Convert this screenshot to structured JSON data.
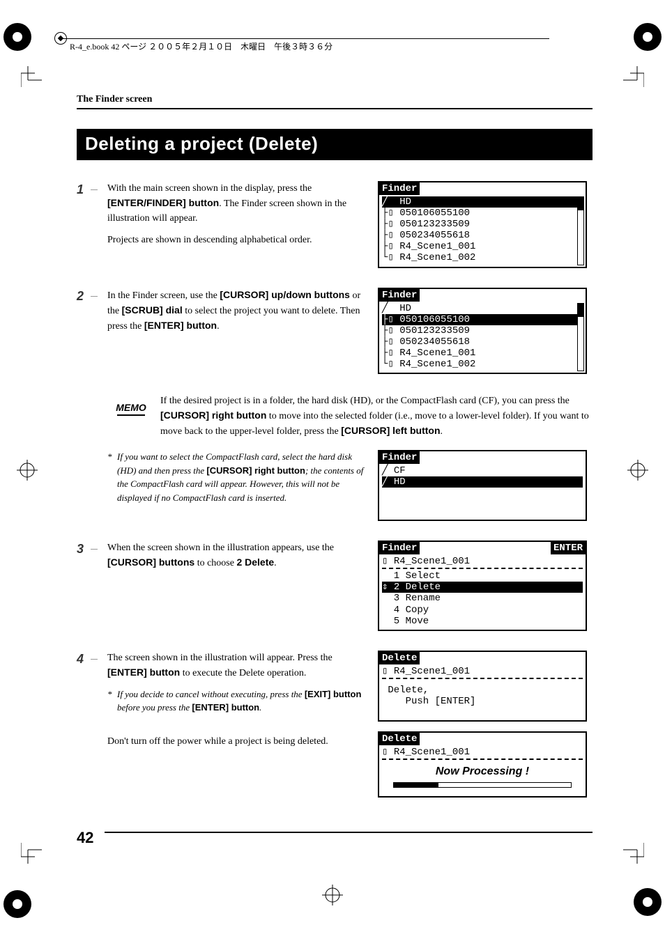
{
  "header": {
    "running": "R-4_e.book  42 ページ  ２００５年２月１０日　木曜日　午後３時３６分"
  },
  "section": "The Finder screen",
  "title": "Deleting a project (Delete)",
  "page_number": "42",
  "steps": {
    "s1": {
      "num": "1",
      "p1a": "With the main screen shown in the display, press the ",
      "p1b": "[ENTER/FINDER] button",
      "p1c": ". The Finder screen shown in the illustration will appear.",
      "p2": "Projects are shown in descending alphabetical order."
    },
    "s2": {
      "num": "2",
      "p1a": "In the Finder screen, use the ",
      "p1b": "[CURSOR] up/down buttons",
      "p1c": " or the ",
      "p1d": "[SCRUB] dial",
      "p1e": " to select the project you want to delete. Then press the ",
      "p1f": "[ENTER] button",
      "p1g": "."
    },
    "memo": {
      "label": "MEMO",
      "t1": "If the desired project is in a folder, the hard disk (HD), or the CompactFlash card (CF), you can press the ",
      "t2": "[CURSOR] right button",
      "t3": " to move into the selected folder (i.e., move to a lower-level folder). If you want to move back to the upper-level folder, press the ",
      "t4": "[CURSOR] left button",
      "t5": "."
    },
    "note_cf": {
      "a": "If you want to select the CompactFlash card, select the hard disk (HD) and then press the ",
      "b": "[CURSOR] right button",
      "c": "; the contents of the CompactFlash card will appear. However, this will not be displayed if no CompactFlash card is inserted."
    },
    "s3": {
      "num": "3",
      "p1a": "When the screen shown in the illustration appears, use the ",
      "p1b": "[CURSOR] buttons",
      "p1c": " to choose ",
      "p1d": "2 Delete",
      "p1e": "."
    },
    "s4": {
      "num": "4",
      "p1a": "The screen shown in the illustration will appear. Press the ",
      "p1b": "[ENTER] button",
      "p1c": " to execute the Delete operation.",
      "n1a": "If you decide to cancel without executing, press the ",
      "n1b": "[EXIT] button",
      "n1c": " before you press the ",
      "n1d": "[ENTER] button",
      "n1e": ".",
      "p2": "Don't turn off the power while a project is being deleted."
    }
  },
  "lcd": {
    "finder1": {
      "title": "Finder",
      "rows": [
        "╱  HD",
        "├▯ 050106055100",
        "├▯ 050123233509",
        "├▯ 050234055618",
        "├▯ R4_Scene1_001",
        "└▯ R4_Scene1_002"
      ],
      "sel_index": 0
    },
    "finder2": {
      "title": "Finder",
      "rows": [
        "╱  HD",
        "├▯ 050106055100",
        "├▯ 050123233509",
        "├▯ 050234055618",
        "├▯ R4_Scene1_001",
        "└▯ R4_Scene1_002"
      ],
      "sel_index": 1
    },
    "finder_cf": {
      "title": "Finder",
      "rows": [
        "╱ CF",
        "╱ HD"
      ],
      "sel_index": 1
    },
    "menu": {
      "title": "Finder",
      "right": "ENTER",
      "sub": "▯ R4_Scene1_001",
      "rows": [
        "  1 Select",
        "⇕ 2 Delete",
        "  3 Rename",
        "  4 Copy",
        "  5 Move"
      ],
      "sel_index": 1
    },
    "delete_confirm": {
      "title": "Delete",
      "sub": "▯ R4_Scene1_001",
      "line1": " Delete,",
      "line2": "    Push [ENTER]"
    },
    "delete_progress": {
      "title": "Delete",
      "sub": "▯ R4_Scene1_001",
      "msg": "Now Processing !"
    }
  }
}
